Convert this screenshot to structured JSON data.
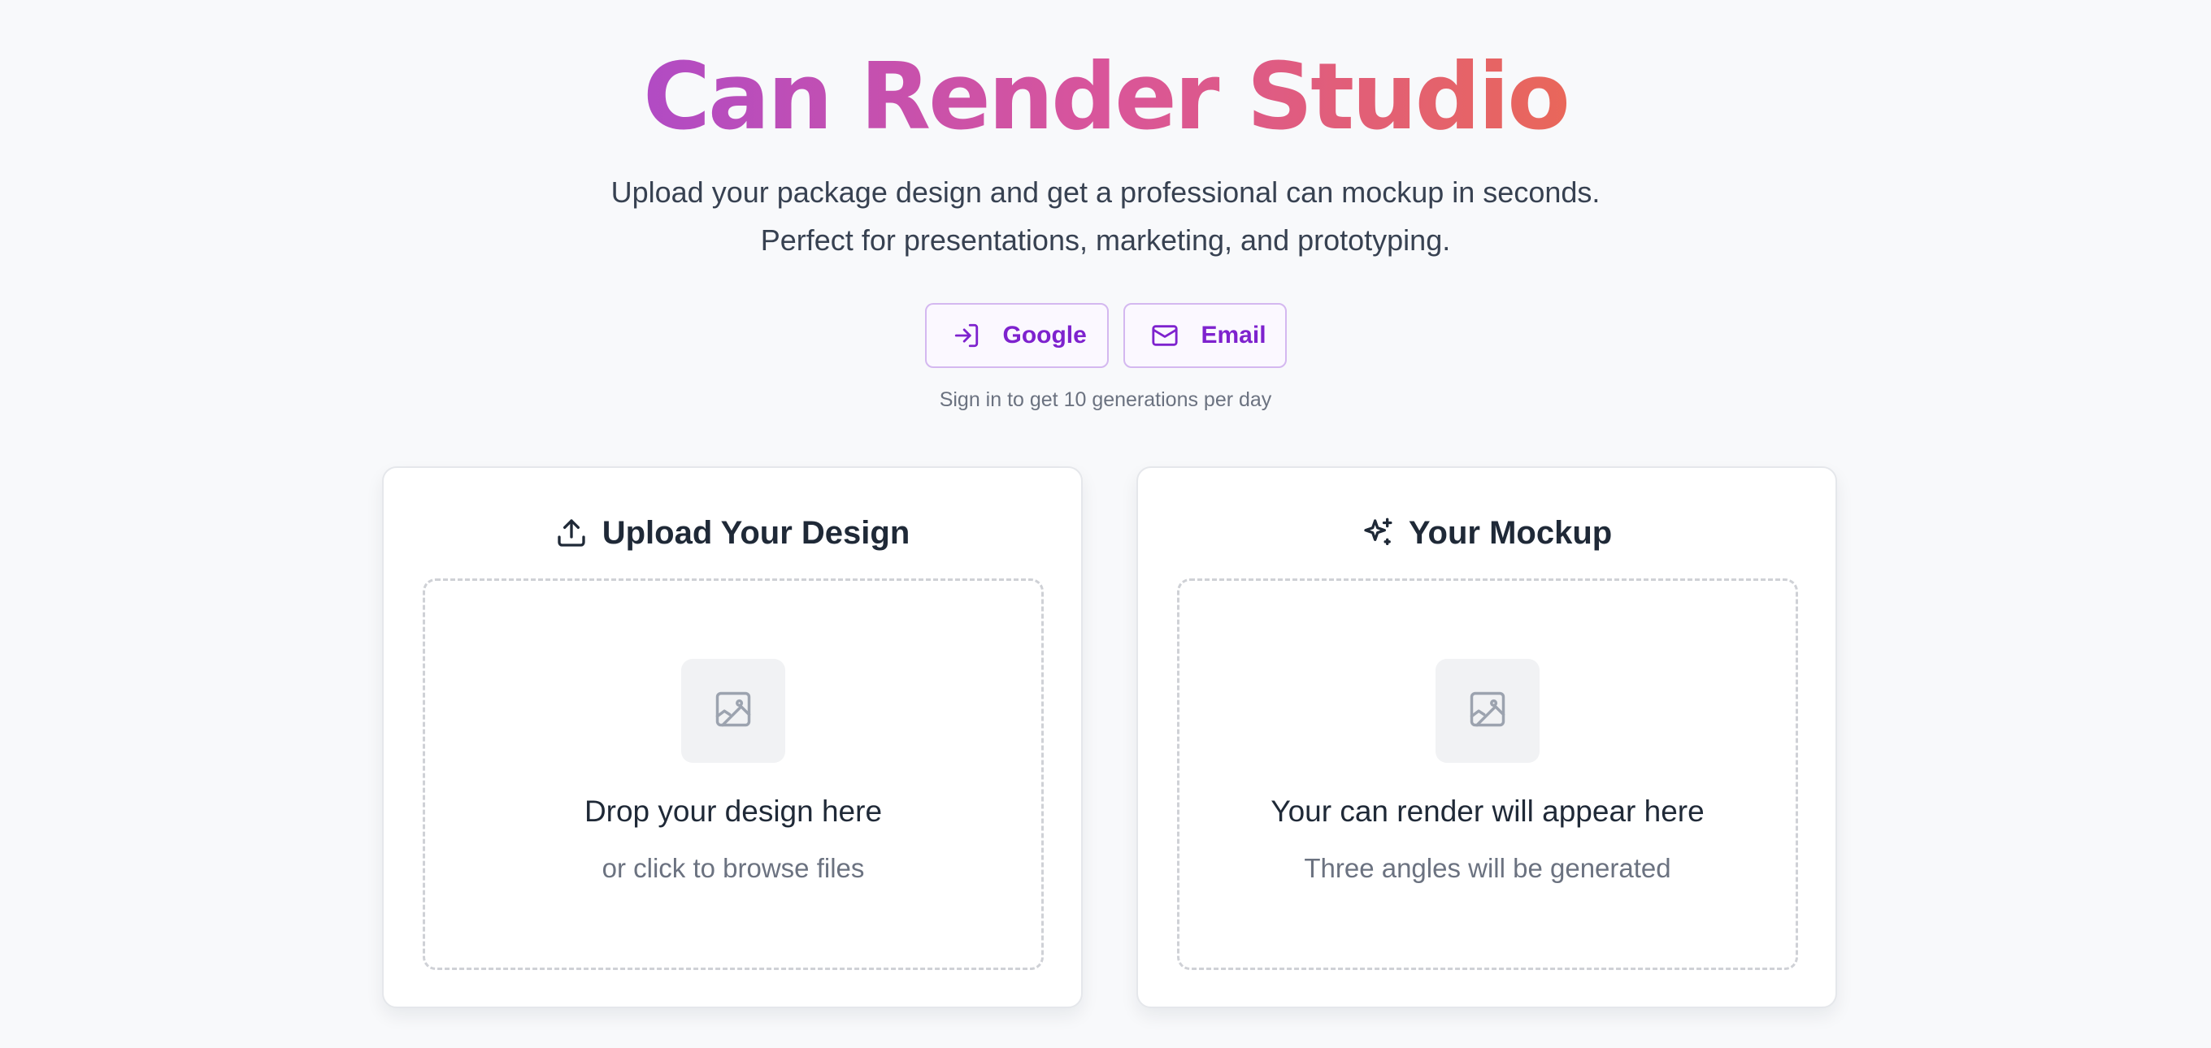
{
  "hero": {
    "title": "Can Render Studio",
    "subtitle_line1": "Upload your package design and get a professional can mockup in seconds.",
    "subtitle_line2": "Perfect for presentations, marketing, and prototyping."
  },
  "auth": {
    "google_label": "Google",
    "email_label": "Email",
    "hint": "Sign in to get 10 generations per day"
  },
  "upload_card": {
    "title": "Upload Your Design",
    "icon": "upload-icon",
    "drop_main": "Drop your design here",
    "drop_sub": "or click to browse files",
    "placeholder_icon": "image-icon"
  },
  "mockup_card": {
    "title": "Your Mockup",
    "icon": "sparkles-icon",
    "drop_main": "Your can render will appear here",
    "drop_sub": "Three angles will be generated",
    "placeholder_icon": "image-icon"
  },
  "colors": {
    "accent": "#7e22ce",
    "gradient_start": "#b14bc4",
    "gradient_end": "#e9675a",
    "background": "#f8f9fb"
  }
}
